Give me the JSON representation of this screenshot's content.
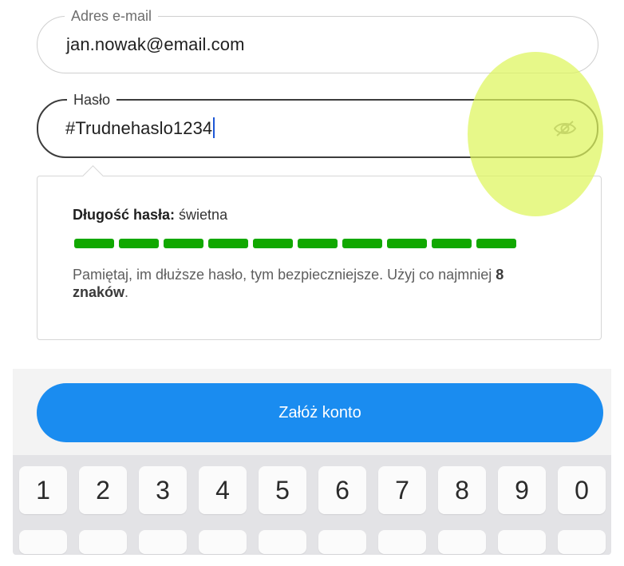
{
  "email_field": {
    "label": "Adres e-mail",
    "value": "jan.nowak@email.com"
  },
  "password_field": {
    "label": "Hasło",
    "value": "#Trudnehaslo1234",
    "visibility_toggle_icon": "eye-off-icon"
  },
  "strength": {
    "label": "Długość hasła:",
    "value": "świetna",
    "level_segments_filled": 10,
    "level_segments_total": 10,
    "bar_color": "#11a800"
  },
  "hint": {
    "text_before": "Pamiętaj, im dłuższe hasło, tym bezpieczniejsze. Użyj co najmniej ",
    "bold": "8 znaków",
    "text_after": "."
  },
  "submit_button": {
    "label": "Załóż konto",
    "color": "#1a8cf0"
  },
  "keyboard": {
    "number_row": [
      "1",
      "2",
      "3",
      "4",
      "5",
      "6",
      "7",
      "8",
      "9",
      "0"
    ]
  },
  "highlight_color": "#def55c"
}
